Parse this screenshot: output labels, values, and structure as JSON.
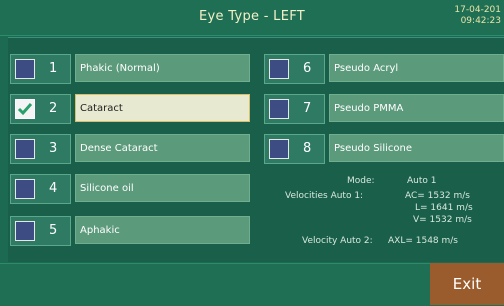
{
  "header": {
    "title": "Eye Type - LEFT",
    "date": "17-04-201",
    "time": "09:42:23"
  },
  "options": [
    {
      "num": "1",
      "label": "Phakic (Normal)",
      "checked": false,
      "selected": false
    },
    {
      "num": "2",
      "label": "Cataract",
      "checked": true,
      "selected": true
    },
    {
      "num": "3",
      "label": "Dense Cataract",
      "checked": false,
      "selected": false
    },
    {
      "num": "4",
      "label": "Silicone oil",
      "checked": false,
      "selected": false
    },
    {
      "num": "5",
      "label": "Aphakic",
      "checked": false,
      "selected": false
    },
    {
      "num": "6",
      "label": "Pseudo Acryl",
      "checked": false,
      "selected": false
    },
    {
      "num": "7",
      "label": "Pseudo PMMA",
      "checked": false,
      "selected": false
    },
    {
      "num": "8",
      "label": "Pseudo Silicone",
      "checked": false,
      "selected": false
    }
  ],
  "info": {
    "mode_label": "Mode:",
    "mode_value": "Auto 1",
    "vel1_label": "Velocities Auto 1:",
    "vel1_ac": "AC= 1532 m/s",
    "vel1_l": "L= 1641 m/s",
    "vel1_v": "V= 1532 m/s",
    "vel2_label": "Velocity Auto 2:",
    "vel2_axl": "AXL= 1548 m/s"
  },
  "footer": {
    "exit_label": "Exit"
  },
  "colors": {
    "check": "#27a06a",
    "selected_border": "#d8bf6a",
    "exit_bg": "#9b5c2d"
  }
}
